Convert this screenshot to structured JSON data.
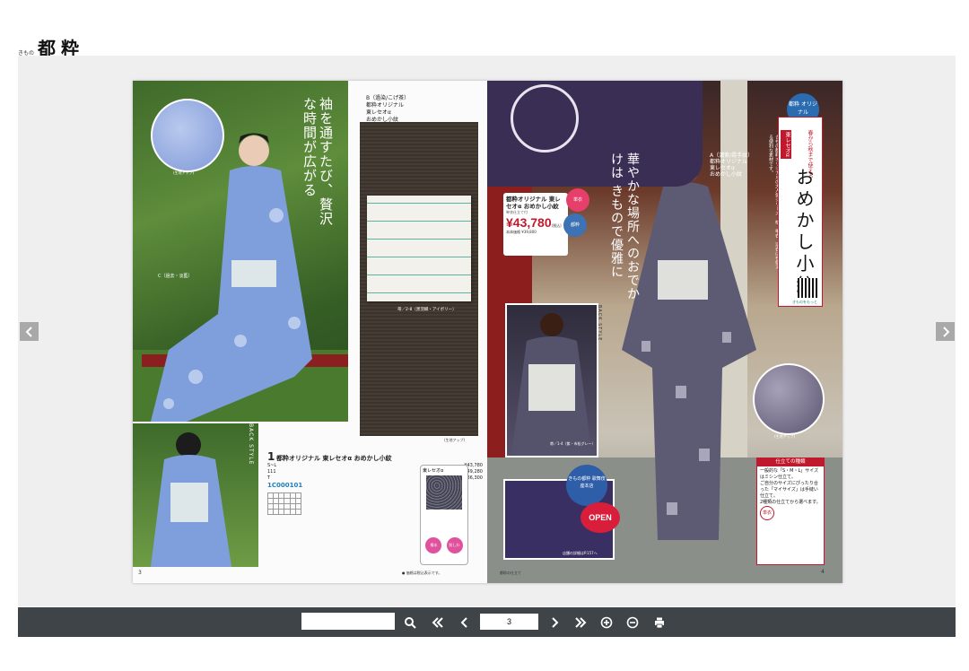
{
  "brand": {
    "small": "きもの",
    "main": "都粋"
  },
  "left_page": {
    "tagline": "袖を通すたび、贅沢な時間が広がる",
    "swatch_label": "(生地アップ)",
    "c_label": "C（過去・淡藍）",
    "fabric_b_head": [
      "B（過染/こげ茶）",
      "都粋オリジナル",
      "東レセオα",
      "おめかし小紋"
    ],
    "fabric_obi_label": "帯／2-8（黒羽織・アイボリー）",
    "fabric_bottom_label": "(生地アップ)",
    "back_style": "BACK STYLE",
    "product": {
      "num": "1",
      "name": "都粋オリジナル 東レセオα おめかし小紋",
      "rows": [
        {
          "label": "S~L",
          "price": "¥43,780"
        },
        {
          "label": "111",
          "price": "¥49,280"
        },
        {
          "label": "T",
          "price": "¥36,300"
        }
      ],
      "code": "1C000101"
    },
    "restyle_title": "東レセオα",
    "restyle_pills": [
      "撥水",
      "防しわ"
    ],
    "page_num": "3",
    "footnote": "● 価格は税込表示です。"
  },
  "right_page": {
    "price_card": {
      "title": "都粋オリジナル 東レセオα おめかし小紋",
      "sub": "単衣仕立て付",
      "price": "¥43,780",
      "price_note": "(税込)",
      "base": "本体価格 ¥39,800"
    },
    "badge_pink": "単衣",
    "badge_blue": "都粋",
    "tagline": "華やかな場所へのおでかけは きもので優雅に",
    "series_badge": "都粋 オリジナル",
    "title_red_tag": "東レセオα",
    "title_sub": "春から秋まで使える",
    "title_main": "おめかし小紋",
    "title_desc": "きもの都粋オリジナルの大人気シリーズ。袷、単衣、浴衣にも使える便利な素材です。",
    "qr_text": "きものをもっと",
    "a_label": [
      "A（濃紫/霞手紋）",
      "都粋オリジナル",
      "東レセオα",
      "おめかし小紋"
    ],
    "swatch_label": "(生地アップ)",
    "back_style": "BACK STYLE",
    "fabric_label": "帯／1-4（紫・市松グレー）",
    "store_badge": "きもの都粋 歌舞伎座本店",
    "open_badge": "OPEN",
    "store_caption": "店舗の詳細はP.157へ",
    "size_box": {
      "title": "仕立ての種類",
      "body": [
        "一般的な「S・M・L」サイズはミシン仕立て。",
        "ご自分のサイズにぴったり合った「マイサイズ」は手縫い仕立て。",
        "2種類の仕立てから選べます。"
      ]
    },
    "stamp": "単衣",
    "page_num": "4",
    "footnote": "都粋の仕立て"
  },
  "toolbar": {
    "search_placeholder": "",
    "page_value": "3",
    "icons": [
      "search-icon",
      "first-page-icon",
      "prev-page-icon",
      "next-page-icon",
      "last-page-icon",
      "zoom-in-icon",
      "zoom-out-icon",
      "print-icon"
    ]
  },
  "colors": {
    "toolbar": "#3f4448",
    "viewer": "#efefef",
    "accent_red": "#c0182c",
    "nav_arrow": "#a9a9a9"
  }
}
